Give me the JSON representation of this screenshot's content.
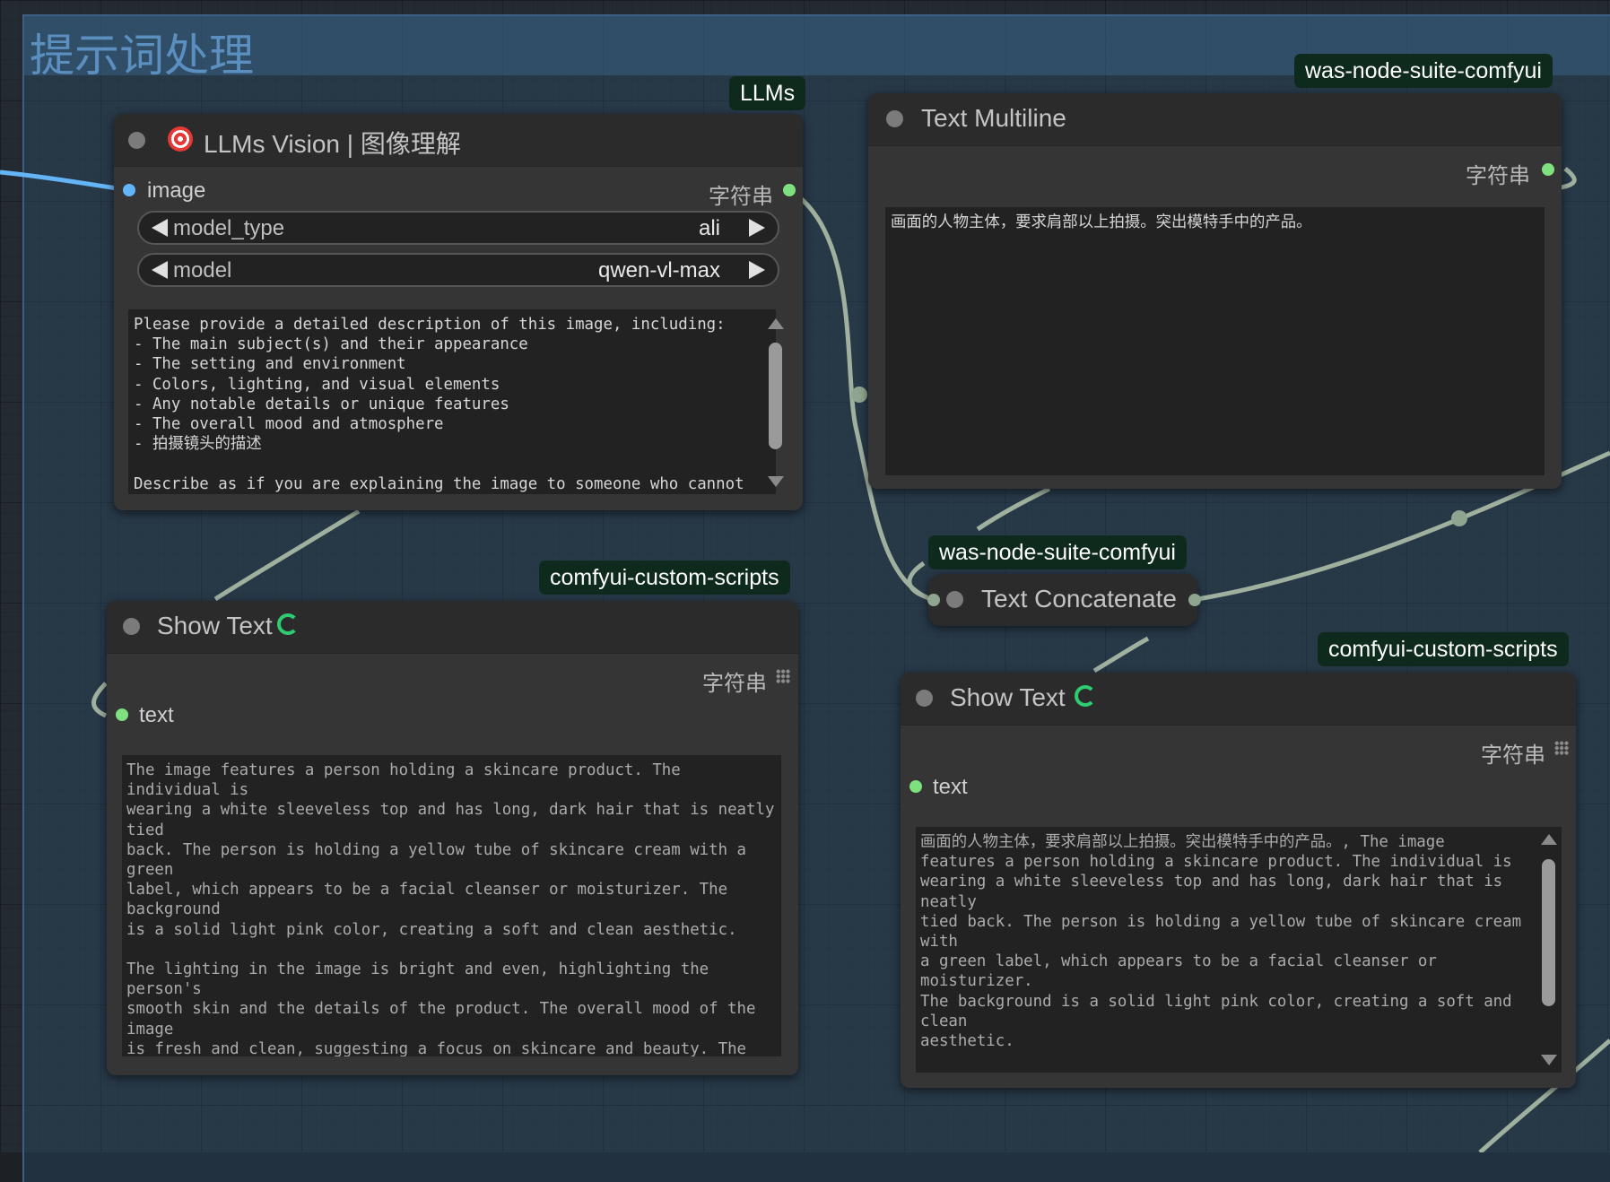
{
  "group": {
    "title": "提示词处理"
  },
  "colors": {
    "wire": "#9fb09f",
    "image_wire": "#64b5f6",
    "string_slot": "#7fe07f",
    "image_slot": "#64b5f6",
    "badge_bg": "#0e2a1d"
  },
  "nodes": {
    "llm_vision": {
      "badge": "LLMs",
      "title": "LLMs Vision | 图像理解",
      "title_icon": "target-dart-icon",
      "input_label": "image",
      "output_label": "字符串",
      "model_type_label": "model_type",
      "model_type_value": "ali",
      "model_label": "model",
      "model_value": "qwen-vl-max",
      "prompt": "Please provide a detailed description of this image, including:\n- The main subject(s) and their appearance\n- The setting and environment\n- Colors, lighting, and visual elements\n- Any notable details or unique features\n- The overall mood and atmosphere\n- 拍摄镜头的描述\n\nDescribe as if you are explaining the image to someone who cannot see"
    },
    "text_multiline": {
      "badge": "was-node-suite-comfyui",
      "title": "Text Multiline",
      "output_label": "字符串",
      "text": "画面的人物主体，要求肩部以上拍摄。突出模特手中的产品。"
    },
    "text_concat": {
      "badge": "was-node-suite-comfyui",
      "title": "Text Concatenate"
    },
    "show_text_left": {
      "badge": "comfyui-custom-scripts",
      "title": "Show Text",
      "title_icon": "snake-icon",
      "output_label": "字符串",
      "input_label": "text",
      "text": "The image features a person holding a skincare product. The individual is\nwearing a white sleeveless top and has long, dark hair that is neatly tied\nback. The person is holding a yellow tube of skincare cream with a green\nlabel, which appears to be a facial cleanser or moisturizer. The background\nis a solid light pink color, creating a soft and clean aesthetic.\n\nThe lighting in the image is bright and even, highlighting the person's\nsmooth skin and the details of the product. The overall mood of the image\nis fresh and clean, suggesting a focus on skincare and beauty. The person's\nexpression is neutral, with a slight smile, adding to the gentle and\napproachable atmosphere of the image. The simplicity of the background and\nthe clear focus on the product and the person make the image feel very\nprofessional and well-composed."
    },
    "show_text_right": {
      "badge": "comfyui-custom-scripts",
      "title": "Show Text",
      "title_icon": "snake-icon",
      "output_label": "字符串",
      "input_label": "text",
      "text": "画面的人物主体，要求肩部以上拍摄。突出模特手中的产品。, The image\nfeatures a person holding a skincare product. The individual is\nwearing a white sleeveless top and has long, dark hair that is neatly\ntied back. The person is holding a yellow tube of skincare cream with\na green label, which appears to be a facial cleanser or moisturizer.\nThe background is a solid light pink color, creating a soft and clean\naesthetic.\n\nThe lighting in the image is bright and even, highlighting the\nperson's smooth skin and the details of the product. The overall mood\nof the image is fresh and clean, suggesting a focus on skincare and\nbeauty. The person's expression is neutral, with a slight smile,\nadding to the gentle and approachable atmosphere of the image. The"
    }
  }
}
